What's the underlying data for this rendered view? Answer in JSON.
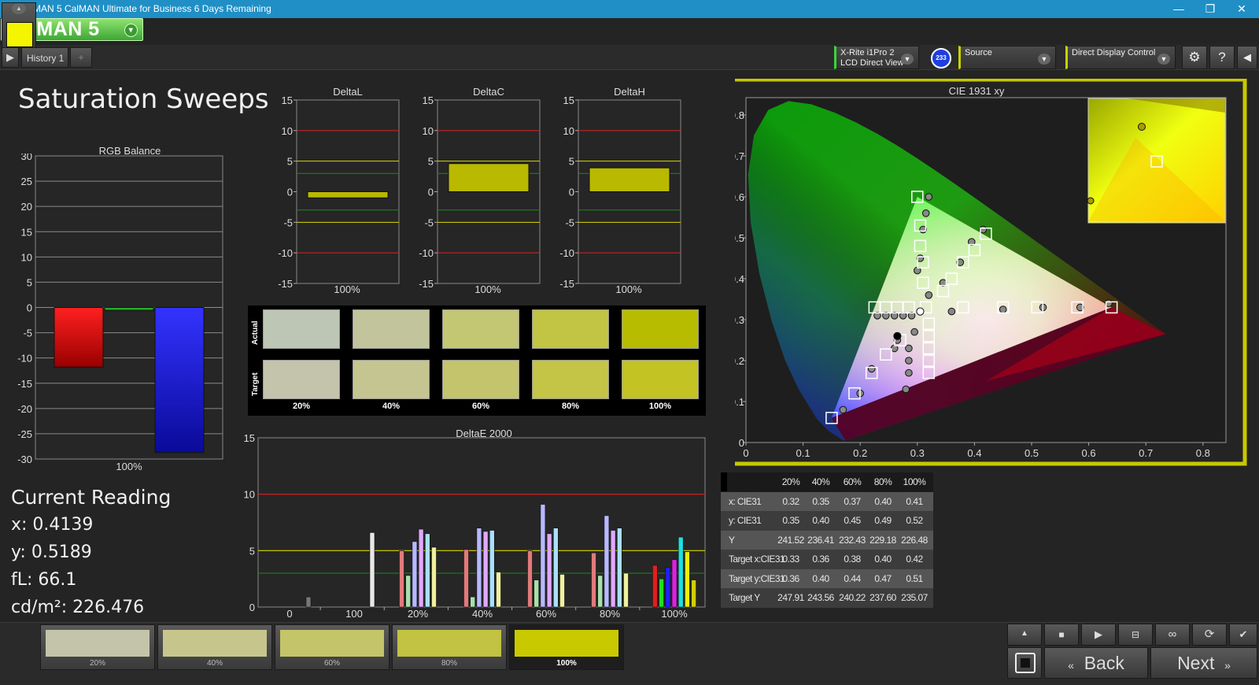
{
  "window": {
    "title": "CalMAN 5 CalMAN Ultimate for Business 6 Days Remaining",
    "icon_label": "5",
    "minimize": "—",
    "restore": "❐",
    "close": "✕"
  },
  "logo": {
    "text": "CalMAN 5",
    "dropdown": "▾"
  },
  "tabs": {
    "play": "▶",
    "tab1": "History 1",
    "add": "+"
  },
  "devices": {
    "meter_line1": "X-Rite i1Pro 2",
    "meter_line2": "LCD Direct View",
    "meter_badge": "233",
    "source": "Source",
    "display": "Direct Display Control",
    "settings_icon": "gear-icon",
    "help": "?",
    "collapse": "◀"
  },
  "page": {
    "title": "Saturation Sweeps"
  },
  "rgb_balance": {
    "title": "RGB Balance",
    "ticks": [
      "30",
      "25",
      "20",
      "15",
      "10",
      "5",
      "0",
      "-5",
      "-10",
      "-15",
      "-20",
      "-25",
      "-30"
    ],
    "xlabel": "100%"
  },
  "delta_charts": [
    {
      "title": "DeltaL",
      "xlabel": "100%"
    },
    {
      "title": "DeltaC",
      "xlabel": "100%"
    },
    {
      "title": "DeltaH",
      "xlabel": "100%"
    }
  ],
  "delta_ticks": [
    "15",
    "10",
    "5",
    "0",
    "-5",
    "-10",
    "-15"
  ],
  "swatches": {
    "actual_label": "Actual",
    "target_label": "Target",
    "labels": [
      "20%",
      "40%",
      "60%",
      "80%",
      "100%"
    ],
    "actual_colors": [
      "#bdc6b4",
      "#c2c59c",
      "#c3c672",
      "#c1c543",
      "#b7bc00"
    ],
    "target_colors": [
      "#c4c4ad",
      "#c5c591",
      "#c4c46d",
      "#c4c446",
      "#c3c324"
    ]
  },
  "deltae": {
    "title": "DeltaE 2000",
    "yticks": [
      "15",
      "10",
      "5",
      "0"
    ],
    "xticks": [
      "0",
      "100",
      "20%",
      "40%",
      "60%",
      "80%",
      "100%"
    ]
  },
  "cie": {
    "title": "CIE 1931 xy",
    "xticks": [
      "0",
      "0.1",
      "0.2",
      "0.3",
      "0.4",
      "0.5",
      "0.6",
      "0.7",
      "0.8"
    ],
    "yticks": [
      "0.8",
      "0.7",
      "0.6",
      "0.5",
      "0.4",
      "0.3",
      "0.2",
      "0.1",
      "0"
    ]
  },
  "current_reading": {
    "title": "Current Reading",
    "x": "x: 0.4139",
    "y": "y: 0.5189",
    "fl": "fL: 66.1",
    "cdm2": "cd/m²: 226.476"
  },
  "table": {
    "headers": [
      "20%",
      "40%",
      "60%",
      "80%",
      "100%"
    ],
    "rows": [
      {
        "label": "x: CIE31",
        "values": [
          "0.32",
          "0.35",
          "0.37",
          "0.40",
          "0.41"
        ]
      },
      {
        "label": "y: CIE31",
        "values": [
          "0.35",
          "0.40",
          "0.45",
          "0.49",
          "0.52"
        ]
      },
      {
        "label": "Y",
        "values": [
          "241.52",
          "236.41",
          "232.43",
          "229.18",
          "226.48"
        ]
      },
      {
        "label": "Target x:CIE31",
        "values": [
          "0.33",
          "0.36",
          "0.38",
          "0.40",
          "0.42"
        ]
      },
      {
        "label": "Target y:CIE31",
        "values": [
          "0.36",
          "0.40",
          "0.44",
          "0.47",
          "0.51"
        ]
      },
      {
        "label": "Target Y",
        "values": [
          "247.91",
          "243.56",
          "240.22",
          "237.60",
          "235.07"
        ]
      }
    ]
  },
  "bottom": {
    "current_color": "#f5f500",
    "patches": [
      {
        "label": "20%",
        "color": "#c4c4aa"
      },
      {
        "label": "40%",
        "color": "#c6c68c"
      },
      {
        "label": "60%",
        "color": "#c4c469"
      },
      {
        "label": "80%",
        "color": "#c2c243"
      },
      {
        "label": "100%",
        "color": "#c9c900"
      }
    ],
    "back": "Back",
    "next": "Next"
  },
  "chart_data": [
    {
      "type": "bar",
      "title": "RGB Balance",
      "categories": [
        "100%"
      ],
      "series": [
        {
          "name": "Red",
          "values": [
            -11.8
          ],
          "color": "#ff0000"
        },
        {
          "name": "Green",
          "values": [
            -0.6
          ],
          "color": "#1aa41a"
        },
        {
          "name": "Blue",
          "values": [
            -28.7
          ],
          "color": "#2020ff"
        }
      ],
      "ylim": [
        -30,
        30
      ]
    },
    {
      "type": "bar",
      "title": "DeltaL",
      "categories": [
        "100%"
      ],
      "values": [
        -1.0
      ],
      "ylim": [
        -15,
        15
      ]
    },
    {
      "type": "bar",
      "title": "DeltaC",
      "categories": [
        "100%"
      ],
      "values": [
        4.6
      ],
      "ylim": [
        -15,
        15
      ]
    },
    {
      "type": "bar",
      "title": "DeltaH",
      "categories": [
        "100%"
      ],
      "values": [
        3.9
      ],
      "ylim": [
        -15,
        15
      ]
    },
    {
      "type": "bar",
      "title": "DeltaE 2000",
      "categories": [
        "0",
        "100",
        "20%",
        "40%",
        "60%",
        "80%",
        "100%"
      ],
      "ylim": [
        0,
        15
      ],
      "series_values": [
        [],
        [
          0.9
        ],
        [
          6.6
        ],
        [
          5.0,
          2.8,
          5.8,
          6.9,
          6.5,
          5.3
        ],
        [
          5.1,
          0.9,
          7.0,
          6.7,
          6.8,
          3.1
        ],
        [
          5.0,
          2.4,
          9.1,
          6.5,
          7.0,
          2.9
        ],
        [
          4.8,
          2.8,
          8.1,
          6.8,
          7.0,
          3.0
        ],
        [
          3.7,
          2.5,
          3.5,
          4.2,
          6.2,
          4.9,
          2.4
        ]
      ],
      "bar_colors": [
        "#e27a7a",
        "#a8e0a8",
        "#b8b8ff",
        "#e0a8ff",
        "#a8e0ff",
        "#f0f0a0"
      ]
    },
    {
      "type": "scatter",
      "title": "CIE 1931 xy",
      "xlim": [
        0,
        0.8
      ],
      "ylim": [
        0,
        0.85
      ],
      "gamut": [
        [
          0.64,
          0.33
        ],
        [
          0.3,
          0.6
        ],
        [
          0.15,
          0.06
        ]
      ],
      "targets": [
        [
          0.15,
          0.06
        ],
        [
          0.19,
          0.12
        ],
        [
          0.22,
          0.17
        ],
        [
          0.245,
          0.215
        ],
        [
          0.27,
          0.25
        ],
        [
          0.3,
          0.6
        ],
        [
          0.305,
          0.53
        ],
        [
          0.305,
          0.48
        ],
        [
          0.31,
          0.44
        ],
        [
          0.31,
          0.39
        ],
        [
          0.64,
          0.33
        ],
        [
          0.58,
          0.33
        ],
        [
          0.51,
          0.33
        ],
        [
          0.45,
          0.33
        ],
        [
          0.38,
          0.33
        ],
        [
          0.225,
          0.33
        ],
        [
          0.245,
          0.33
        ],
        [
          0.265,
          0.33
        ],
        [
          0.285,
          0.33
        ],
        [
          0.32,
          0.17
        ],
        [
          0.32,
          0.2
        ],
        [
          0.32,
          0.23
        ],
        [
          0.32,
          0.26
        ],
        [
          0.32,
          0.29
        ],
        [
          0.42,
          0.51
        ],
        [
          0.4,
          0.47
        ],
        [
          0.38,
          0.44
        ],
        [
          0.36,
          0.4
        ],
        [
          0.345,
          0.37
        ],
        [
          0.315,
          0.33
        ]
      ],
      "actuals": [
        [
          0.17,
          0.08
        ],
        [
          0.2,
          0.12
        ],
        [
          0.22,
          0.18
        ],
        [
          0.26,
          0.23
        ],
        [
          0.265,
          0.25
        ],
        [
          0.32,
          0.6
        ],
        [
          0.315,
          0.56
        ],
        [
          0.31,
          0.52
        ],
        [
          0.305,
          0.45
        ],
        [
          0.3,
          0.42
        ],
        [
          0.635,
          0.34
        ],
        [
          0.585,
          0.33
        ],
        [
          0.52,
          0.33
        ],
        [
          0.45,
          0.325
        ],
        [
          0.36,
          0.32
        ],
        [
          0.23,
          0.31
        ],
        [
          0.245,
          0.31
        ],
        [
          0.26,
          0.31
        ],
        [
          0.275,
          0.31
        ],
        [
          0.29,
          0.31
        ],
        [
          0.28,
          0.13
        ],
        [
          0.285,
          0.17
        ],
        [
          0.285,
          0.2
        ],
        [
          0.285,
          0.23
        ],
        [
          0.295,
          0.27
        ],
        [
          0.415,
          0.52
        ],
        [
          0.395,
          0.49
        ],
        [
          0.375,
          0.44
        ],
        [
          0.345,
          0.39
        ],
        [
          0.32,
          0.36
        ]
      ],
      "current": [
        0.4139,
        0.5189
      ]
    }
  ]
}
